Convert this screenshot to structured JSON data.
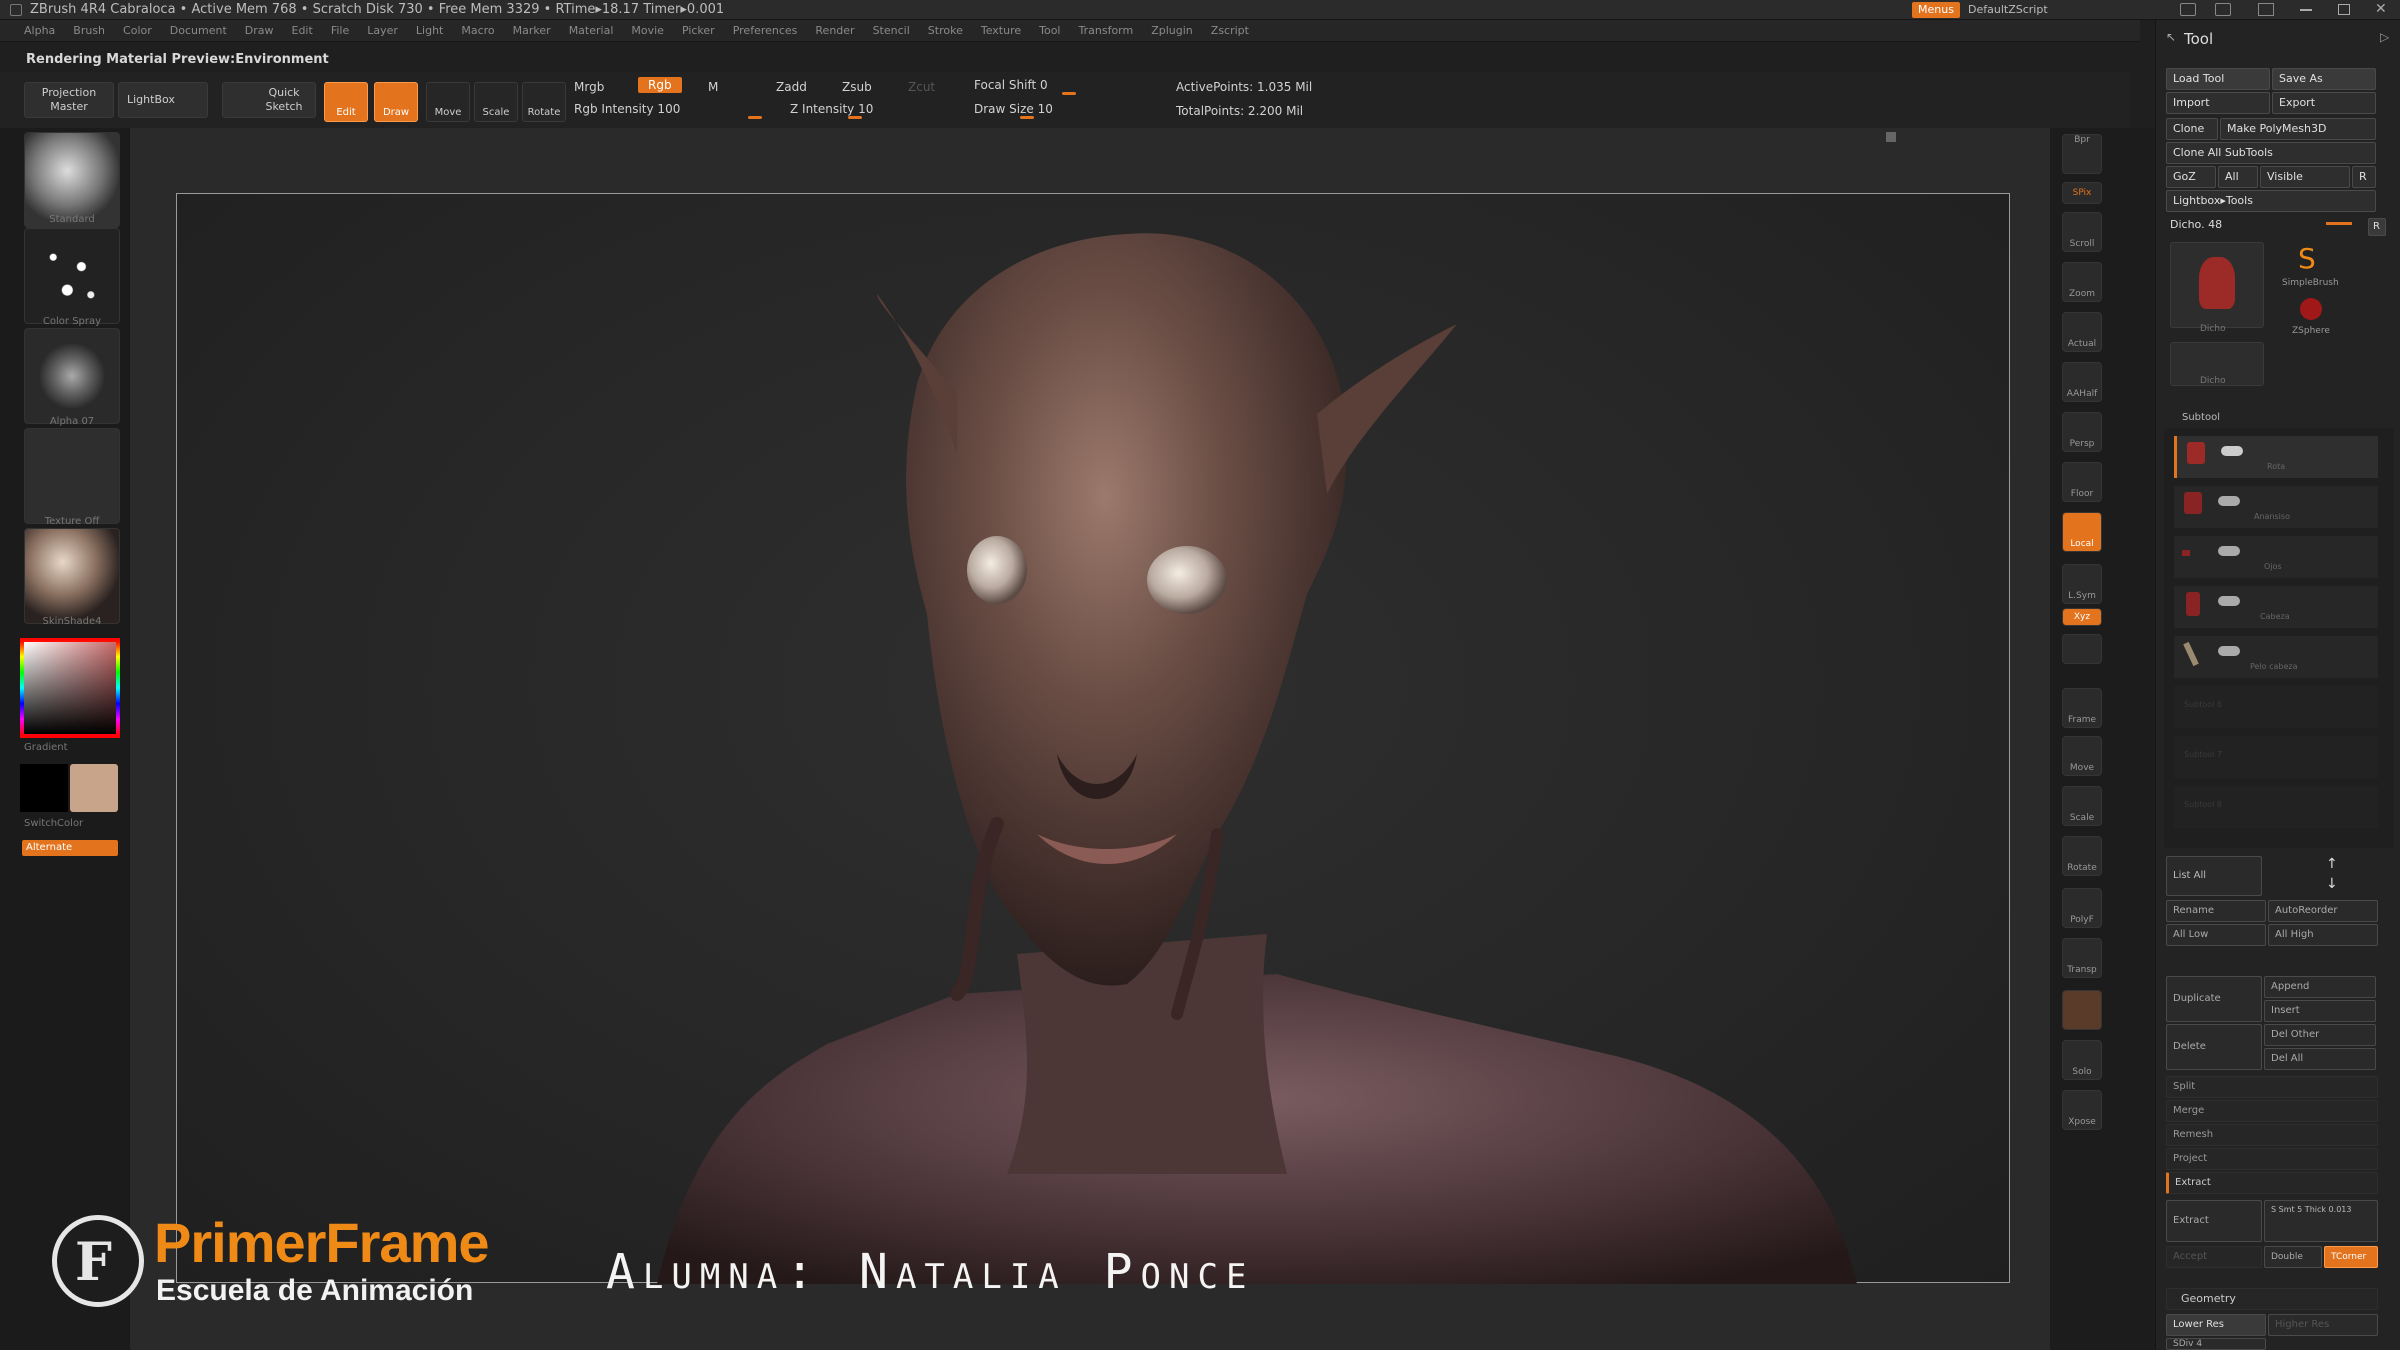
{
  "titlebar": {
    "text": "ZBrush 4R4   Cabraloca   • Active Mem 768 • Scratch Disk 730 • Free Mem 3329 • RTime▸18.17 Timer▸0.001",
    "menus_btn": "Menus",
    "script_btn": "DefaultZScript"
  },
  "menubar": [
    "Alpha",
    "Brush",
    "Color",
    "Document",
    "Draw",
    "Edit",
    "File",
    "Layer",
    "Light",
    "Macro",
    "Marker",
    "Material",
    "Movie",
    "Picker",
    "Preferences",
    "Render",
    "Stencil",
    "Stroke",
    "Texture",
    "Tool",
    "Transform",
    "Zplugin",
    "Zscript"
  ],
  "status_label": "Rendering Material Preview:Environment",
  "toolbar": {
    "projection_master": "Projection Master",
    "lightbox": "LightBox",
    "quick_sketch": "Quick Sketch",
    "edit": "Edit",
    "draw": "Draw",
    "move": "Move",
    "scale": "Scale",
    "rotate": "Rotate",
    "mrgb": "Mrgb",
    "rgb": "Rgb",
    "m": "M",
    "rgb_intensity": "Rgb  Intensity 100",
    "zadd": "Zadd",
    "zsub": "Zsub",
    "zcut": "Zcut",
    "z_intensity": "Z Intensity 10",
    "focal_shift": "Focal Shift 0",
    "draw_size": "Draw Size 10",
    "active_points": "ActivePoints: 1.035 Mil",
    "total_points": "TotalPoints: 2.200 Mil"
  },
  "leftshelf": {
    "brush": "Standard",
    "stroke": "Color Spray",
    "alpha": "Alpha 07",
    "texture": "Texture Off",
    "material": "SkinShade4",
    "gradient": "Gradient",
    "switch_color": "SwitchColor",
    "alternate": "Alternate"
  },
  "rightshelf": [
    "Bpr",
    "SPix",
    "Scroll",
    "Zoom",
    "Actual",
    "AAHalf",
    "Persp",
    "Floor",
    "Local",
    "L.Sym",
    "Xyz",
    "",
    "Frame",
    "Move",
    "Scale",
    "Rotate",
    "PolyF",
    "Transp",
    "",
    "Solo",
    "Xpose"
  ],
  "toolpanel": {
    "title": "Tool",
    "load_tool": "Load Tool",
    "save_as": "Save As",
    "import": "Import",
    "export": "Export",
    "clone": "Clone",
    "make_polymesh": "Make PolyMesh3D",
    "clone_all": "Clone All SubTools",
    "goz": "GoZ",
    "all": "All",
    "visible": "Visible",
    "r": "R",
    "lightbox_tools": "Lightbox▸Tools",
    "current_tool": "Dicho. 48",
    "thumb_1": "Dicho",
    "thumb_2": "SimpleBrush",
    "thumb_3": "ZSphere",
    "thumb_4": "Dicho",
    "subtool": "Subtool",
    "subtools": [
      "Rota",
      "Anansiso",
      "Ojos",
      "Cabeza",
      "Pelo cabeza",
      "Subtool 6",
      "Subtool 7",
      "Subtool 8"
    ],
    "list_all": "List All",
    "rename": "Rename",
    "autoreorder": "AutoReorder",
    "all_low": "All Low",
    "all_high": "All High",
    "duplicate": "Duplicate",
    "append": "Append",
    "insert": "Insert",
    "delete": "Delete",
    "del_other": "Del Other",
    "del_all": "Del All",
    "split": "Split",
    "merge": "Merge",
    "remesh": "Remesh",
    "project": "Project",
    "extract": "Extract",
    "extract_btn": "Extract",
    "smt": "S Smt 5  Thick 0.013",
    "accept": "Accept",
    "double": "Double",
    "tcorner": "TCorner",
    "geometry": "Geometry",
    "lower_res": "Lower Res",
    "higher_res": "Higher Res",
    "sdiv": "SDiv 4"
  },
  "watermark": {
    "brand": "PrimerFrame",
    "school": "Escuela de Animación",
    "credit": "Alumna: Natalia Ponce"
  },
  "colors": {
    "accent": "#e3731d",
    "brand_orange": "#f08a16"
  }
}
